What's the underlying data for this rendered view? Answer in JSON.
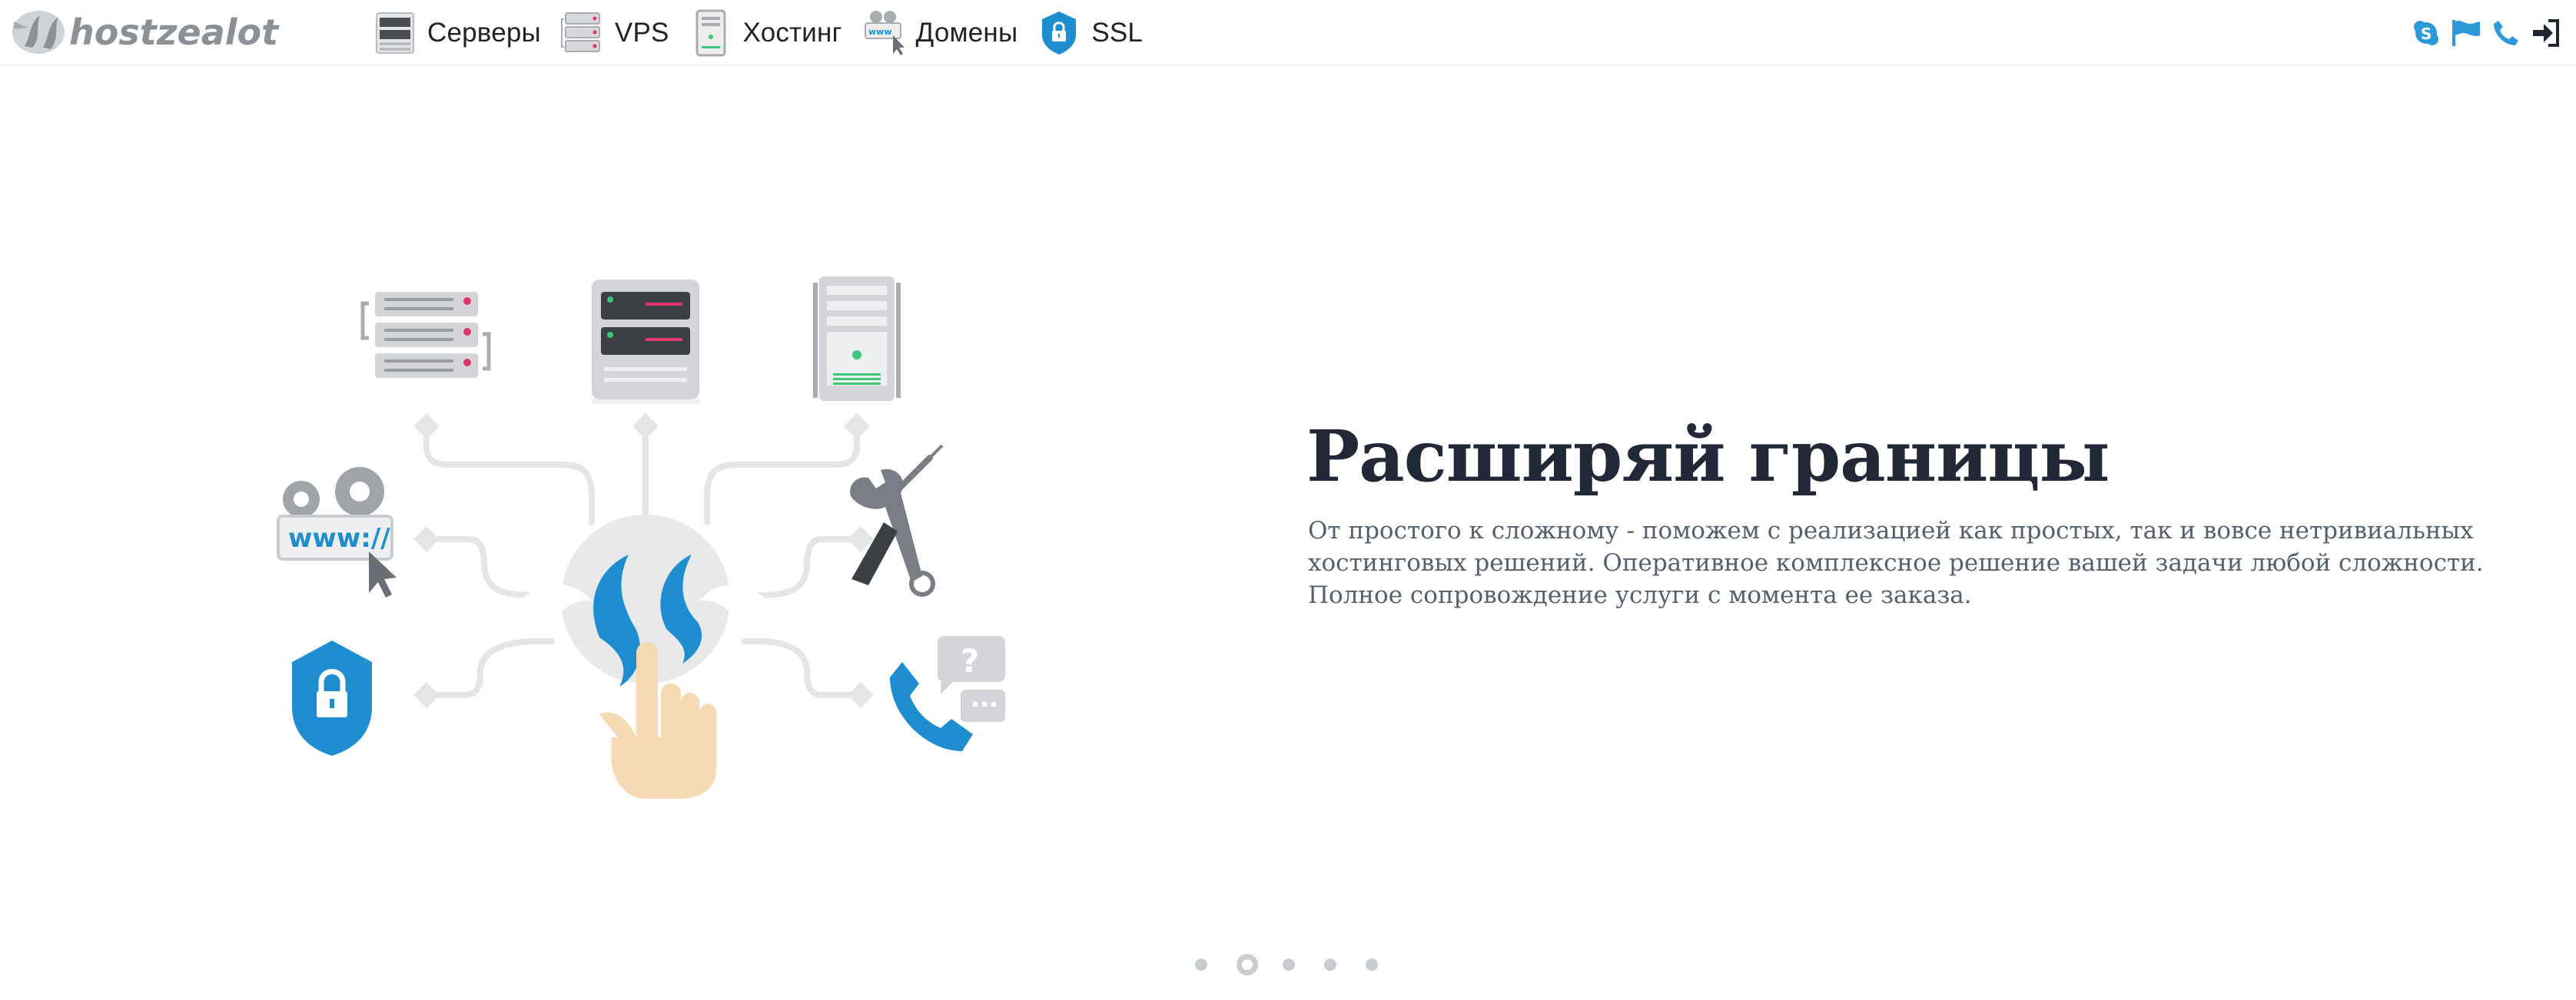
{
  "header": {
    "logo_text": "hostzealot",
    "nav": [
      {
        "label": "Серверы",
        "icon": "server-rack-icon"
      },
      {
        "label": "VPS",
        "icon": "vps-stack-icon"
      },
      {
        "label": "Хостинг",
        "icon": "hosting-tower-icon"
      },
      {
        "label": "Домены",
        "icon": "domain-www-icon"
      },
      {
        "label": "SSL",
        "icon": "ssl-shield-icon"
      }
    ],
    "right_icons": [
      "skype-icon",
      "flag-icon",
      "phone-icon",
      "sign-in-icon"
    ]
  },
  "hero": {
    "title": "Расширяй границы",
    "text": "От простого к сложному - поможем с реализацией как простых, так и вовсе нетривиальных хостинговых решений. Оперативное комплексное решение вашей задачи любой сложности. Полное сопровождение услуги с момента ее заказа.",
    "art_www": "www://"
  },
  "slider": {
    "count": 5,
    "active": 2
  },
  "colors": {
    "brand_blue": "#1f8ed1",
    "text_dark": "#222838",
    "text_muted": "#55606c",
    "gray": "#c9cdd2",
    "accent_red": "#e3356b",
    "accent_green": "#3fc77a"
  }
}
